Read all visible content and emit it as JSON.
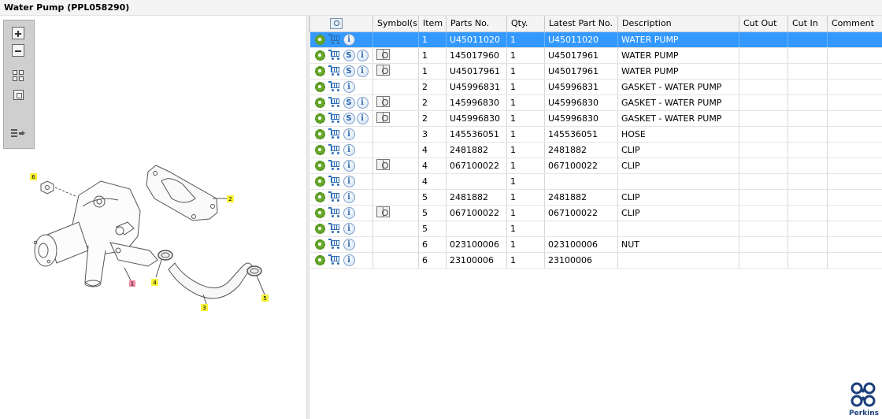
{
  "window": {
    "title": "Water Pump (PPL058290)"
  },
  "toolbox": {
    "buttons": [
      "zoom-in",
      "zoom-out",
      "fit-all",
      "fit-window",
      "show-list"
    ]
  },
  "diagram": {
    "callouts": [
      "6",
      "2",
      "4",
      "1",
      "3",
      "5"
    ]
  },
  "table": {
    "headers": [
      "Symbol(s)",
      "Item",
      "Parts No.",
      "Qty.",
      "Latest Part No.",
      "Description",
      "Cut Out",
      "Cut In",
      "Comment"
    ],
    "rows": [
      {
        "s": false,
        "book": false,
        "item": "1",
        "part": "U45011020",
        "qty": "1",
        "latest": "U45011020",
        "desc": "WATER PUMP"
      },
      {
        "s": true,
        "book": true,
        "item": "1",
        "part": "145017960",
        "qty": "1",
        "latest": "U45017961",
        "desc": "WATER PUMP"
      },
      {
        "s": true,
        "book": true,
        "item": "1",
        "part": "U45017961",
        "qty": "1",
        "latest": "U45017961",
        "desc": "WATER PUMP"
      },
      {
        "s": false,
        "book": false,
        "item": "2",
        "part": "U45996831",
        "qty": "1",
        "latest": "U45996831",
        "desc": "GASKET - WATER PUMP"
      },
      {
        "s": true,
        "book": true,
        "item": "2",
        "part": "145996830",
        "qty": "1",
        "latest": "U45996830",
        "desc": "GASKET - WATER PUMP"
      },
      {
        "s": true,
        "book": true,
        "item": "2",
        "part": "U45996830",
        "qty": "1",
        "latest": "U45996830",
        "desc": "GASKET - WATER PUMP"
      },
      {
        "s": false,
        "book": false,
        "item": "3",
        "part": "145536051",
        "qty": "1",
        "latest": "145536051",
        "desc": "HOSE"
      },
      {
        "s": false,
        "book": false,
        "item": "4",
        "part": "2481882",
        "qty": "1",
        "latest": "2481882",
        "desc": "CLIP"
      },
      {
        "s": false,
        "book": true,
        "item": "4",
        "part": "067100022",
        "qty": "1",
        "latest": "067100022",
        "desc": "CLIP"
      },
      {
        "s": false,
        "book": false,
        "item": "4",
        "part": "",
        "qty": "1",
        "latest": "",
        "desc": ""
      },
      {
        "s": false,
        "book": false,
        "item": "5",
        "part": "2481882",
        "qty": "1",
        "latest": "2481882",
        "desc": "CLIP"
      },
      {
        "s": false,
        "book": true,
        "item": "5",
        "part": "067100022",
        "qty": "1",
        "latest": "067100022",
        "desc": "CLIP"
      },
      {
        "s": false,
        "book": false,
        "item": "5",
        "part": "",
        "qty": "1",
        "latest": "",
        "desc": ""
      },
      {
        "s": false,
        "book": false,
        "item": "6",
        "part": "023100006",
        "qty": "1",
        "latest": "023100006",
        "desc": "NUT"
      },
      {
        "s": false,
        "book": false,
        "item": "6",
        "part": "23100006",
        "qty": "1",
        "latest": "23100006",
        "desc": ""
      }
    ],
    "selected_row": 0
  },
  "brand": {
    "name": "Perkins",
    "color": "#1b3f7a"
  },
  "colors": {
    "selection": "#3399ff",
    "gear": "#6aab2e",
    "cart": "#2e6db4"
  }
}
